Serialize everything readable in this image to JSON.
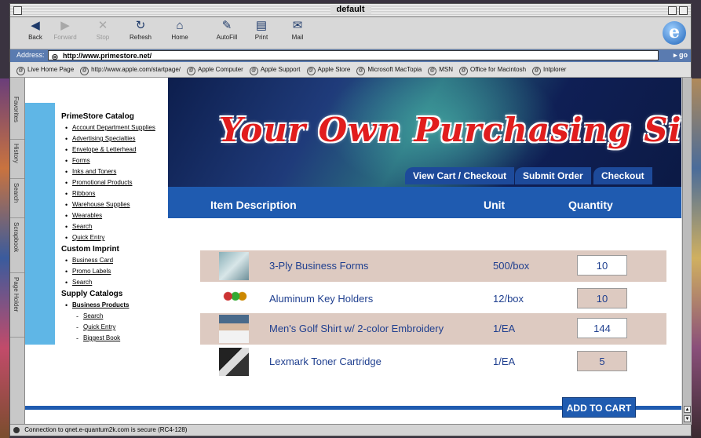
{
  "window": {
    "title": "default"
  },
  "toolbar": {
    "buttons": [
      {
        "label": "Back",
        "icon": "back-arrow-icon",
        "glyph": "◀",
        "enabled": true
      },
      {
        "label": "Forward",
        "icon": "forward-arrow-icon",
        "glyph": "▶",
        "enabled": false
      },
      {
        "label": "Stop",
        "icon": "stop-x-icon",
        "glyph": "✕",
        "enabled": false
      },
      {
        "label": "Refresh",
        "icon": "refresh-icon",
        "glyph": "↻",
        "enabled": true
      },
      {
        "label": "Home",
        "icon": "home-icon",
        "glyph": "⌂",
        "enabled": true
      },
      {
        "label": "AutoFill",
        "icon": "autofill-icon",
        "glyph": "✎",
        "enabled": true
      },
      {
        "label": "Print",
        "icon": "printer-icon",
        "glyph": "▤",
        "enabled": true
      },
      {
        "label": "Mail",
        "icon": "mail-icon",
        "glyph": "✉",
        "enabled": true
      }
    ],
    "logo": "e"
  },
  "address": {
    "label": "Address:",
    "url": "http://www.primestore.net/",
    "go": "go"
  },
  "favorites": [
    "Live Home Page",
    "http://www.apple.com/startpage/",
    "Apple Computer",
    "Apple Support",
    "Apple Store",
    "Microsoft MacTopia",
    "MSN",
    "Office for Macintosh",
    "Intplorer"
  ],
  "sidetabs": [
    "Favorites",
    "History",
    "Search",
    "Scrapbook",
    "Page Holder"
  ],
  "nav": {
    "sections": [
      {
        "title": "PrimeStore Catalog",
        "items": [
          {
            "label": "Account Department Supplies"
          },
          {
            "label": "Advertising Specialties"
          },
          {
            "label": "Envelope & Letterhead"
          },
          {
            "label": "Forms"
          },
          {
            "label": "Inks and Toners"
          },
          {
            "label": "Promotional Products"
          },
          {
            "label": "Ribbons"
          },
          {
            "label": "Warehouse Supplies"
          },
          {
            "label": "Wearables"
          },
          {
            "label": "Search"
          },
          {
            "label": "Quick Entry"
          }
        ]
      },
      {
        "title": "Custom Imprint",
        "items": [
          {
            "label": "Business Card"
          },
          {
            "label": "Promo Labels"
          },
          {
            "label": "Search"
          }
        ]
      },
      {
        "title": "Supply Catalogs",
        "items": [
          {
            "label": "Business Products",
            "bold": true
          },
          {
            "label": "Search",
            "sub": true
          },
          {
            "label": "Quick Entry",
            "sub": true
          },
          {
            "label": "Biggest Book",
            "sub": true
          }
        ]
      }
    ]
  },
  "banner": {
    "headline": "Your Own Purchasing Site",
    "links": [
      "View Cart / Checkout",
      "Submit Order",
      "Checkout"
    ]
  },
  "table": {
    "headers": {
      "description": "Item Description",
      "unit": "Unit",
      "quantity": "Quantity"
    },
    "rows": [
      {
        "description": "3-Ply Business Forms",
        "unit": "500/box",
        "quantity": "10",
        "thumb": "forms-thumbnail"
      },
      {
        "description": "Aluminum Key Holders",
        "unit": "12/box",
        "quantity": "10",
        "thumb": "key-holders-thumbnail"
      },
      {
        "description": "Men's Golf Shirt w/ 2-color Embroidery",
        "unit": "1/EA",
        "quantity": "144",
        "thumb": "golf-shirt-thumbnail"
      },
      {
        "description": "Lexmark Toner Cartridge",
        "unit": "1/EA",
        "quantity": "5",
        "thumb": "toner-thumbnail"
      }
    ]
  },
  "add_to_cart": "ADD TO CART",
  "status": "Connection to qnet.e-quantum2k.com is secure (RC4-128)",
  "colors": {
    "accent_blue": "#1f5bb0",
    "row_shade": "#ddcac1",
    "headline_red": "#e11d1d",
    "cyan_strip": "#5fb6e6"
  }
}
